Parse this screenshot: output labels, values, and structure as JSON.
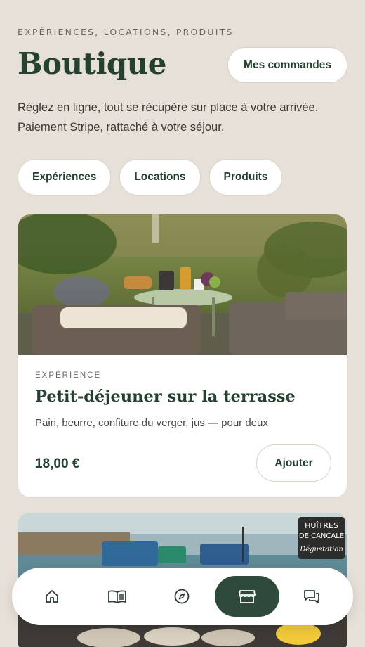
{
  "header": {
    "eyebrow": "EXPÉRIENCES, LOCATIONS, PRODUITS",
    "title": "Boutique",
    "orders_label": "Mes commandes"
  },
  "intro": {
    "line1": "Réglez en ligne, tout se récupère sur place à votre arrivée.",
    "line2": "Paiement Stripe, rattaché à votre séjour."
  },
  "filters": [
    "Expériences",
    "Locations",
    "Produits"
  ],
  "product": {
    "kicker": "EXPÉRIENCE",
    "title": "Petit-déjeuner sur la terrasse",
    "description": "Pain, beurre, confiture du verger, jus — pour deux",
    "price": "18,00 €",
    "add_label": "Ajouter",
    "image": "breakfast-terrace-photo"
  },
  "product2": {
    "image": "harbour-oysters-photo",
    "sign_line1": "HUÎTRES",
    "sign_line2": "DE CANCALE",
    "sign_line3": "Dégustation"
  },
  "tabbar": {
    "items": [
      {
        "icon": "home-icon"
      },
      {
        "icon": "book-icon"
      },
      {
        "icon": "compass-icon"
      },
      {
        "icon": "shop-icon",
        "active": true
      },
      {
        "icon": "chat-icon"
      }
    ]
  },
  "colors": {
    "background": "#e6e0d8",
    "accent": "#24402f",
    "active_tab": "#2e4a3a"
  }
}
